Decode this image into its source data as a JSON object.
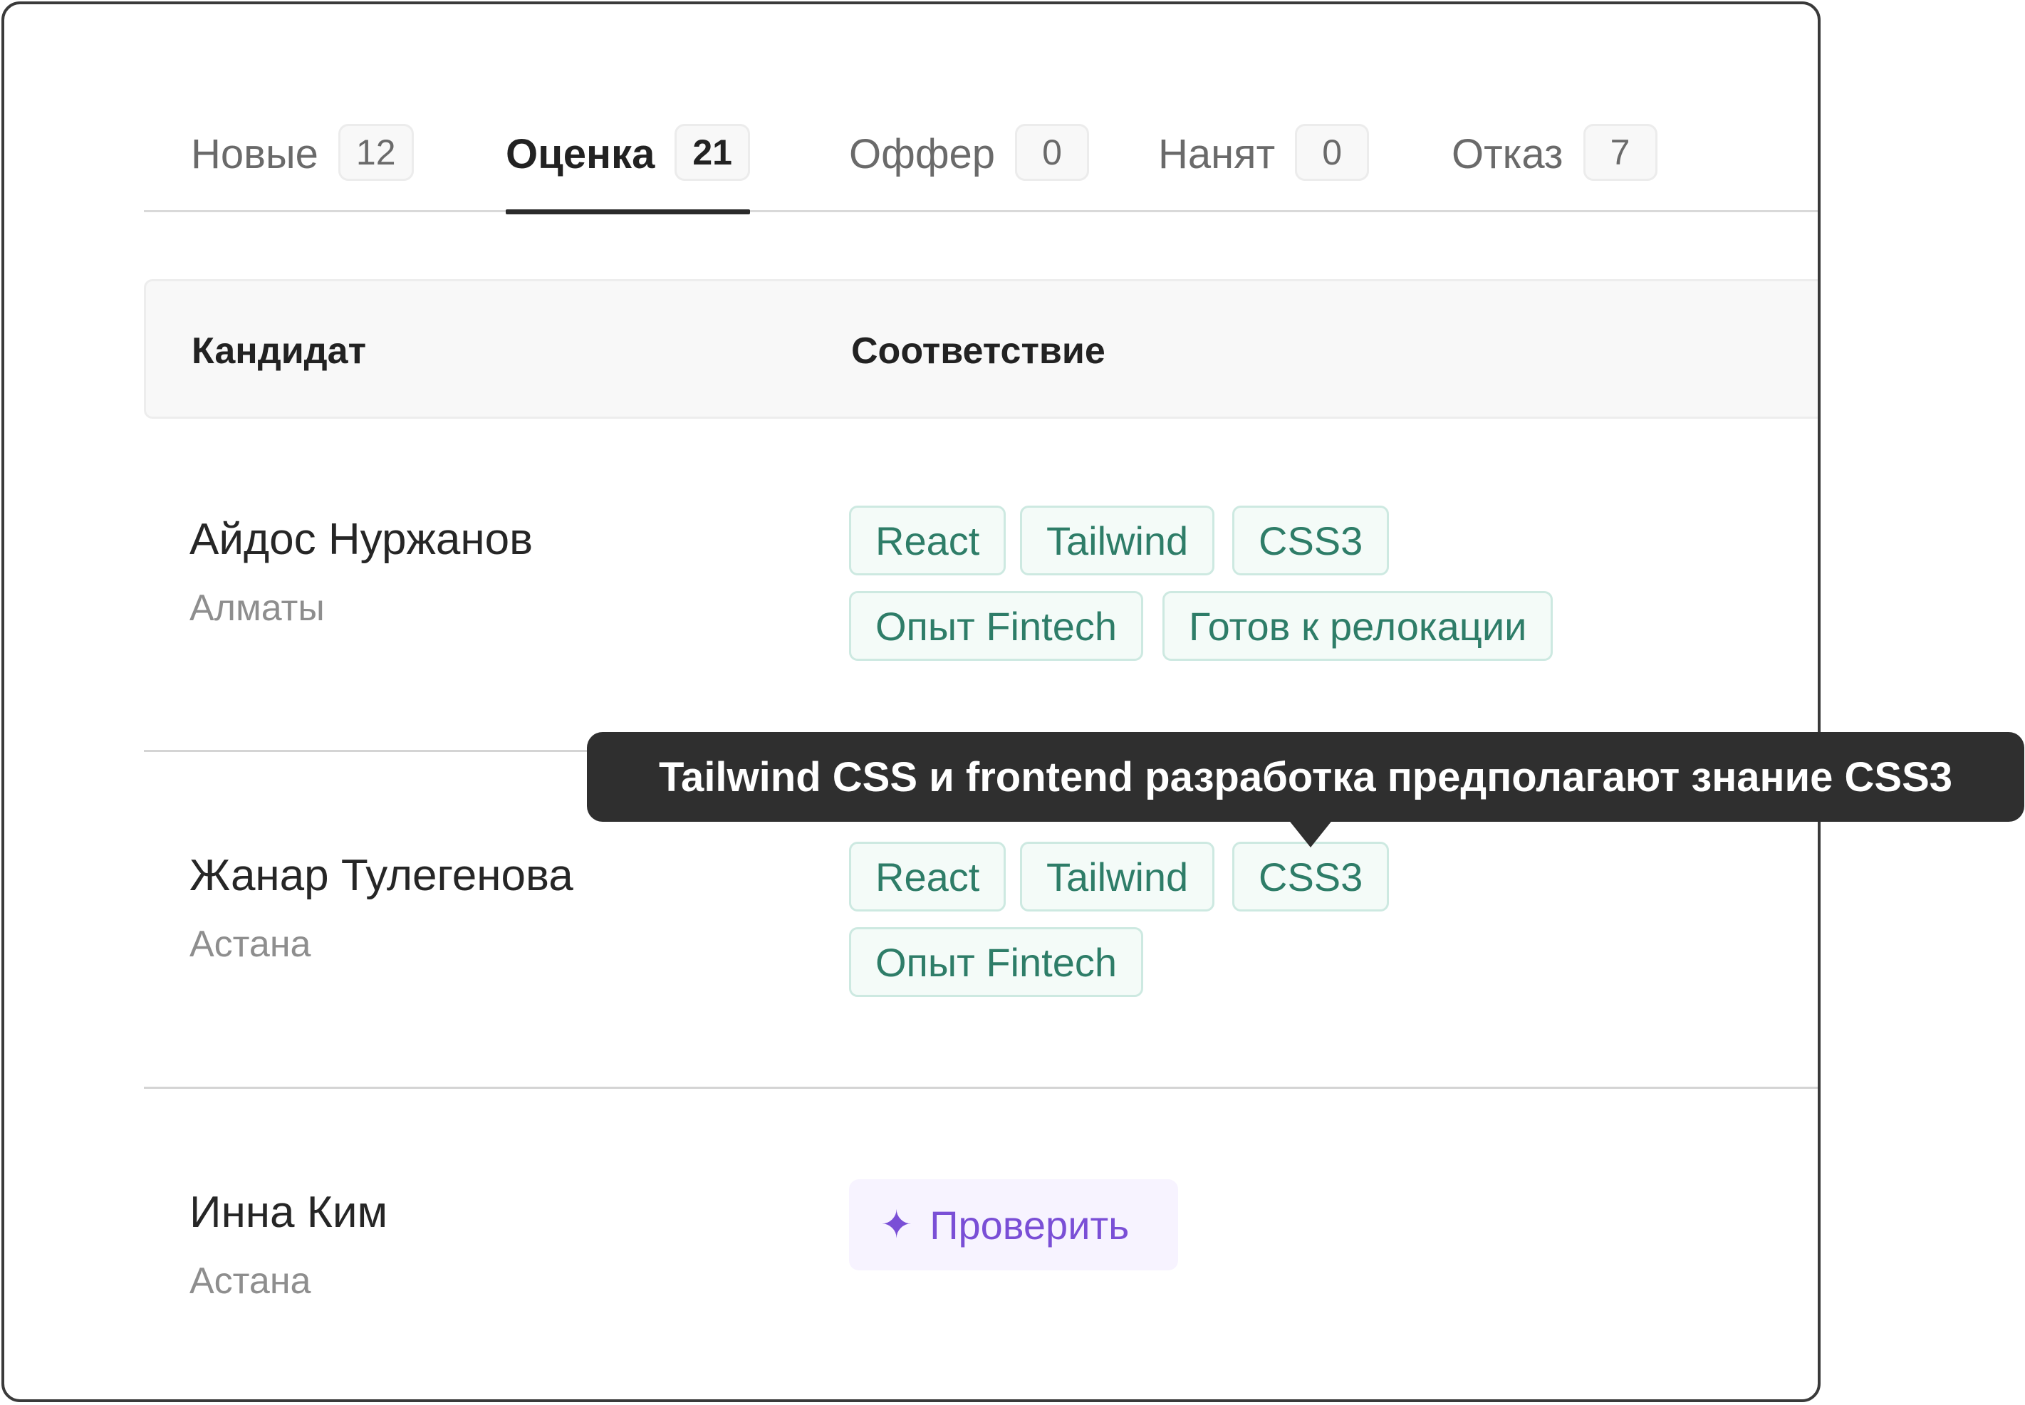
{
  "tabs": [
    {
      "label": "Новые",
      "count": "12"
    },
    {
      "label": "Оценка",
      "count": "21"
    },
    {
      "label": "Оффер",
      "count": "0"
    },
    {
      "label": "Нанят",
      "count": "0"
    },
    {
      "label": "Отказ",
      "count": "7"
    }
  ],
  "table": {
    "headers": {
      "candidate": "Кандидат",
      "match": "Соответствие"
    },
    "rows": [
      {
        "name": "Айдос Нуржанов",
        "city": "Алматы",
        "tags": [
          "React",
          "Tailwind",
          "CSS3",
          "Опыт Fintech",
          "Готов к релокации"
        ]
      },
      {
        "name": "Жанар Тулегенова",
        "city": "Астана",
        "tags": [
          "React",
          "Tailwind",
          "CSS3",
          "Опыт Fintech"
        ]
      },
      {
        "name": "Инна Ким",
        "city": "Астана",
        "action": {
          "icon": "sparkle-icon",
          "label": "Проверить"
        }
      }
    ]
  },
  "tooltip": {
    "text": "Tailwind CSS и frontend разработка предполагают знание CSS3"
  },
  "colors": {
    "tag_text": "#2e7d68",
    "tag_bg": "#f4fbf8",
    "tag_border": "#cde9e1",
    "action_text": "#7a4fd6",
    "action_bg": "#f7f3ff",
    "tooltip_bg": "#2f2f2f"
  }
}
